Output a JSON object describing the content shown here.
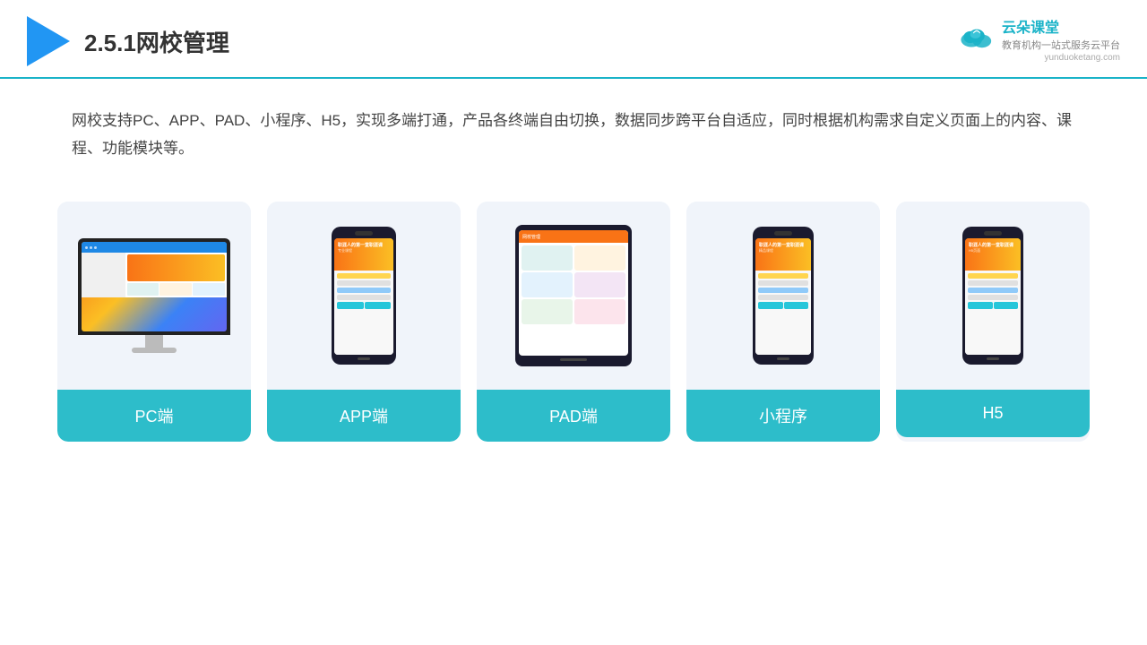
{
  "header": {
    "title": "2.5.1网校管理",
    "brand_name": "云朵课堂",
    "brand_url": "yunduoketang.com",
    "brand_slogan1": "教育机构一站",
    "brand_slogan2": "式服务云平台"
  },
  "description": {
    "text": "网校支持PC、APP、PAD、小程序、H5，实现多端打通，产品各终端自由切换，数据同步跨平台自适应，同时根据机构需求自定义页面上的内容、课程、功能模块等。"
  },
  "cards": [
    {
      "id": "pc",
      "label": "PC端"
    },
    {
      "id": "app",
      "label": "APP端"
    },
    {
      "id": "pad",
      "label": "PAD端"
    },
    {
      "id": "miniapp",
      "label": "小程序"
    },
    {
      "id": "h5",
      "label": "H5"
    }
  ]
}
